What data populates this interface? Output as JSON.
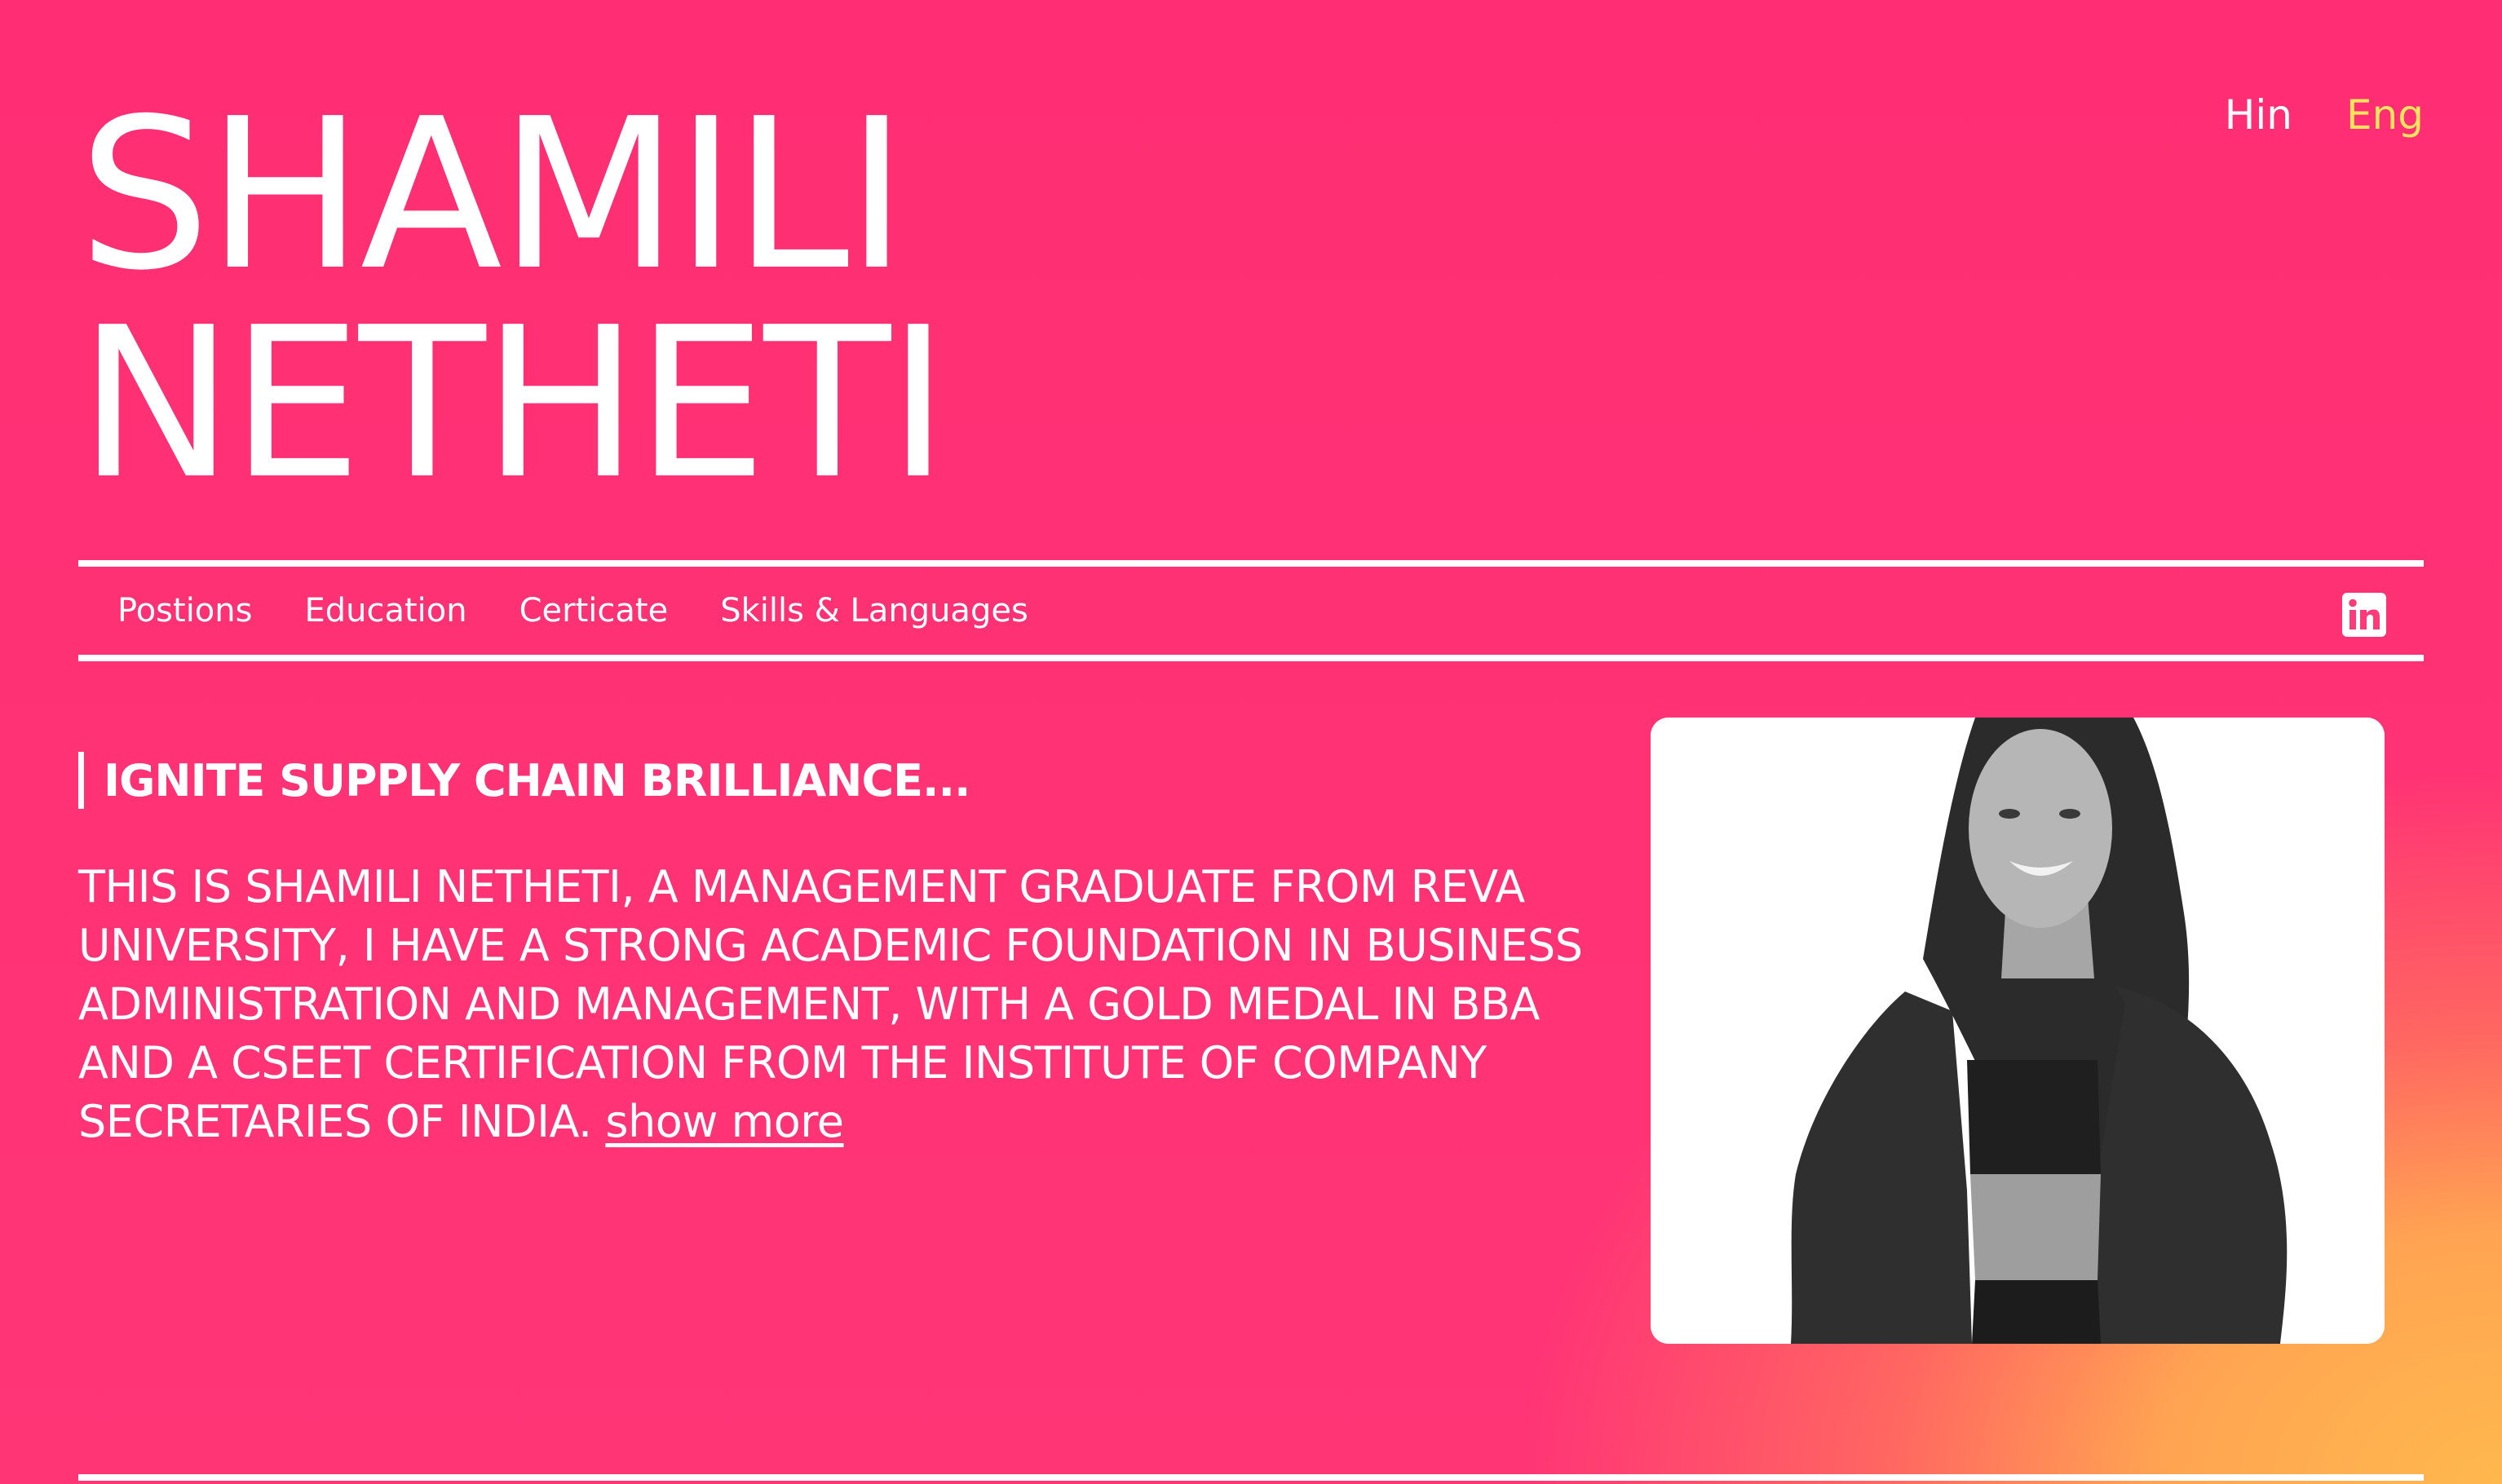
{
  "header": {
    "name_line1": "SHAMILI",
    "name_line2": "NETHETI"
  },
  "language": {
    "options": [
      "Hin",
      "Eng"
    ],
    "selected": "Eng"
  },
  "nav": {
    "items": [
      "Postions",
      "Education",
      "Certicate",
      "Skills & Languages"
    ],
    "social_icon": "linkedin-icon"
  },
  "hero": {
    "tagline": "IGNITE SUPPLY CHAIN BRILLIANCE...",
    "bio": "THIS IS SHAMILI NETHETI, A MANAGEMENT GRADUATE FROM REVA UNIVERSITY, I HAVE A STRONG ACADEMIC FOUNDATION IN BUSINESS ADMINISTRATION AND MANAGEMENT, WITH A GOLD MEDAL IN BBA AND A CSEET CERTIFICATION FROM THE INSTITUTE OF COMPANY SECRETARIES OF INDIA.",
    "show_more": "show more",
    "photo": "profile-photo"
  },
  "colors": {
    "background_pink": "#ff3276",
    "background_orange": "#ffb84d",
    "text": "#ffffff",
    "selected_language": "#ffe45c"
  }
}
